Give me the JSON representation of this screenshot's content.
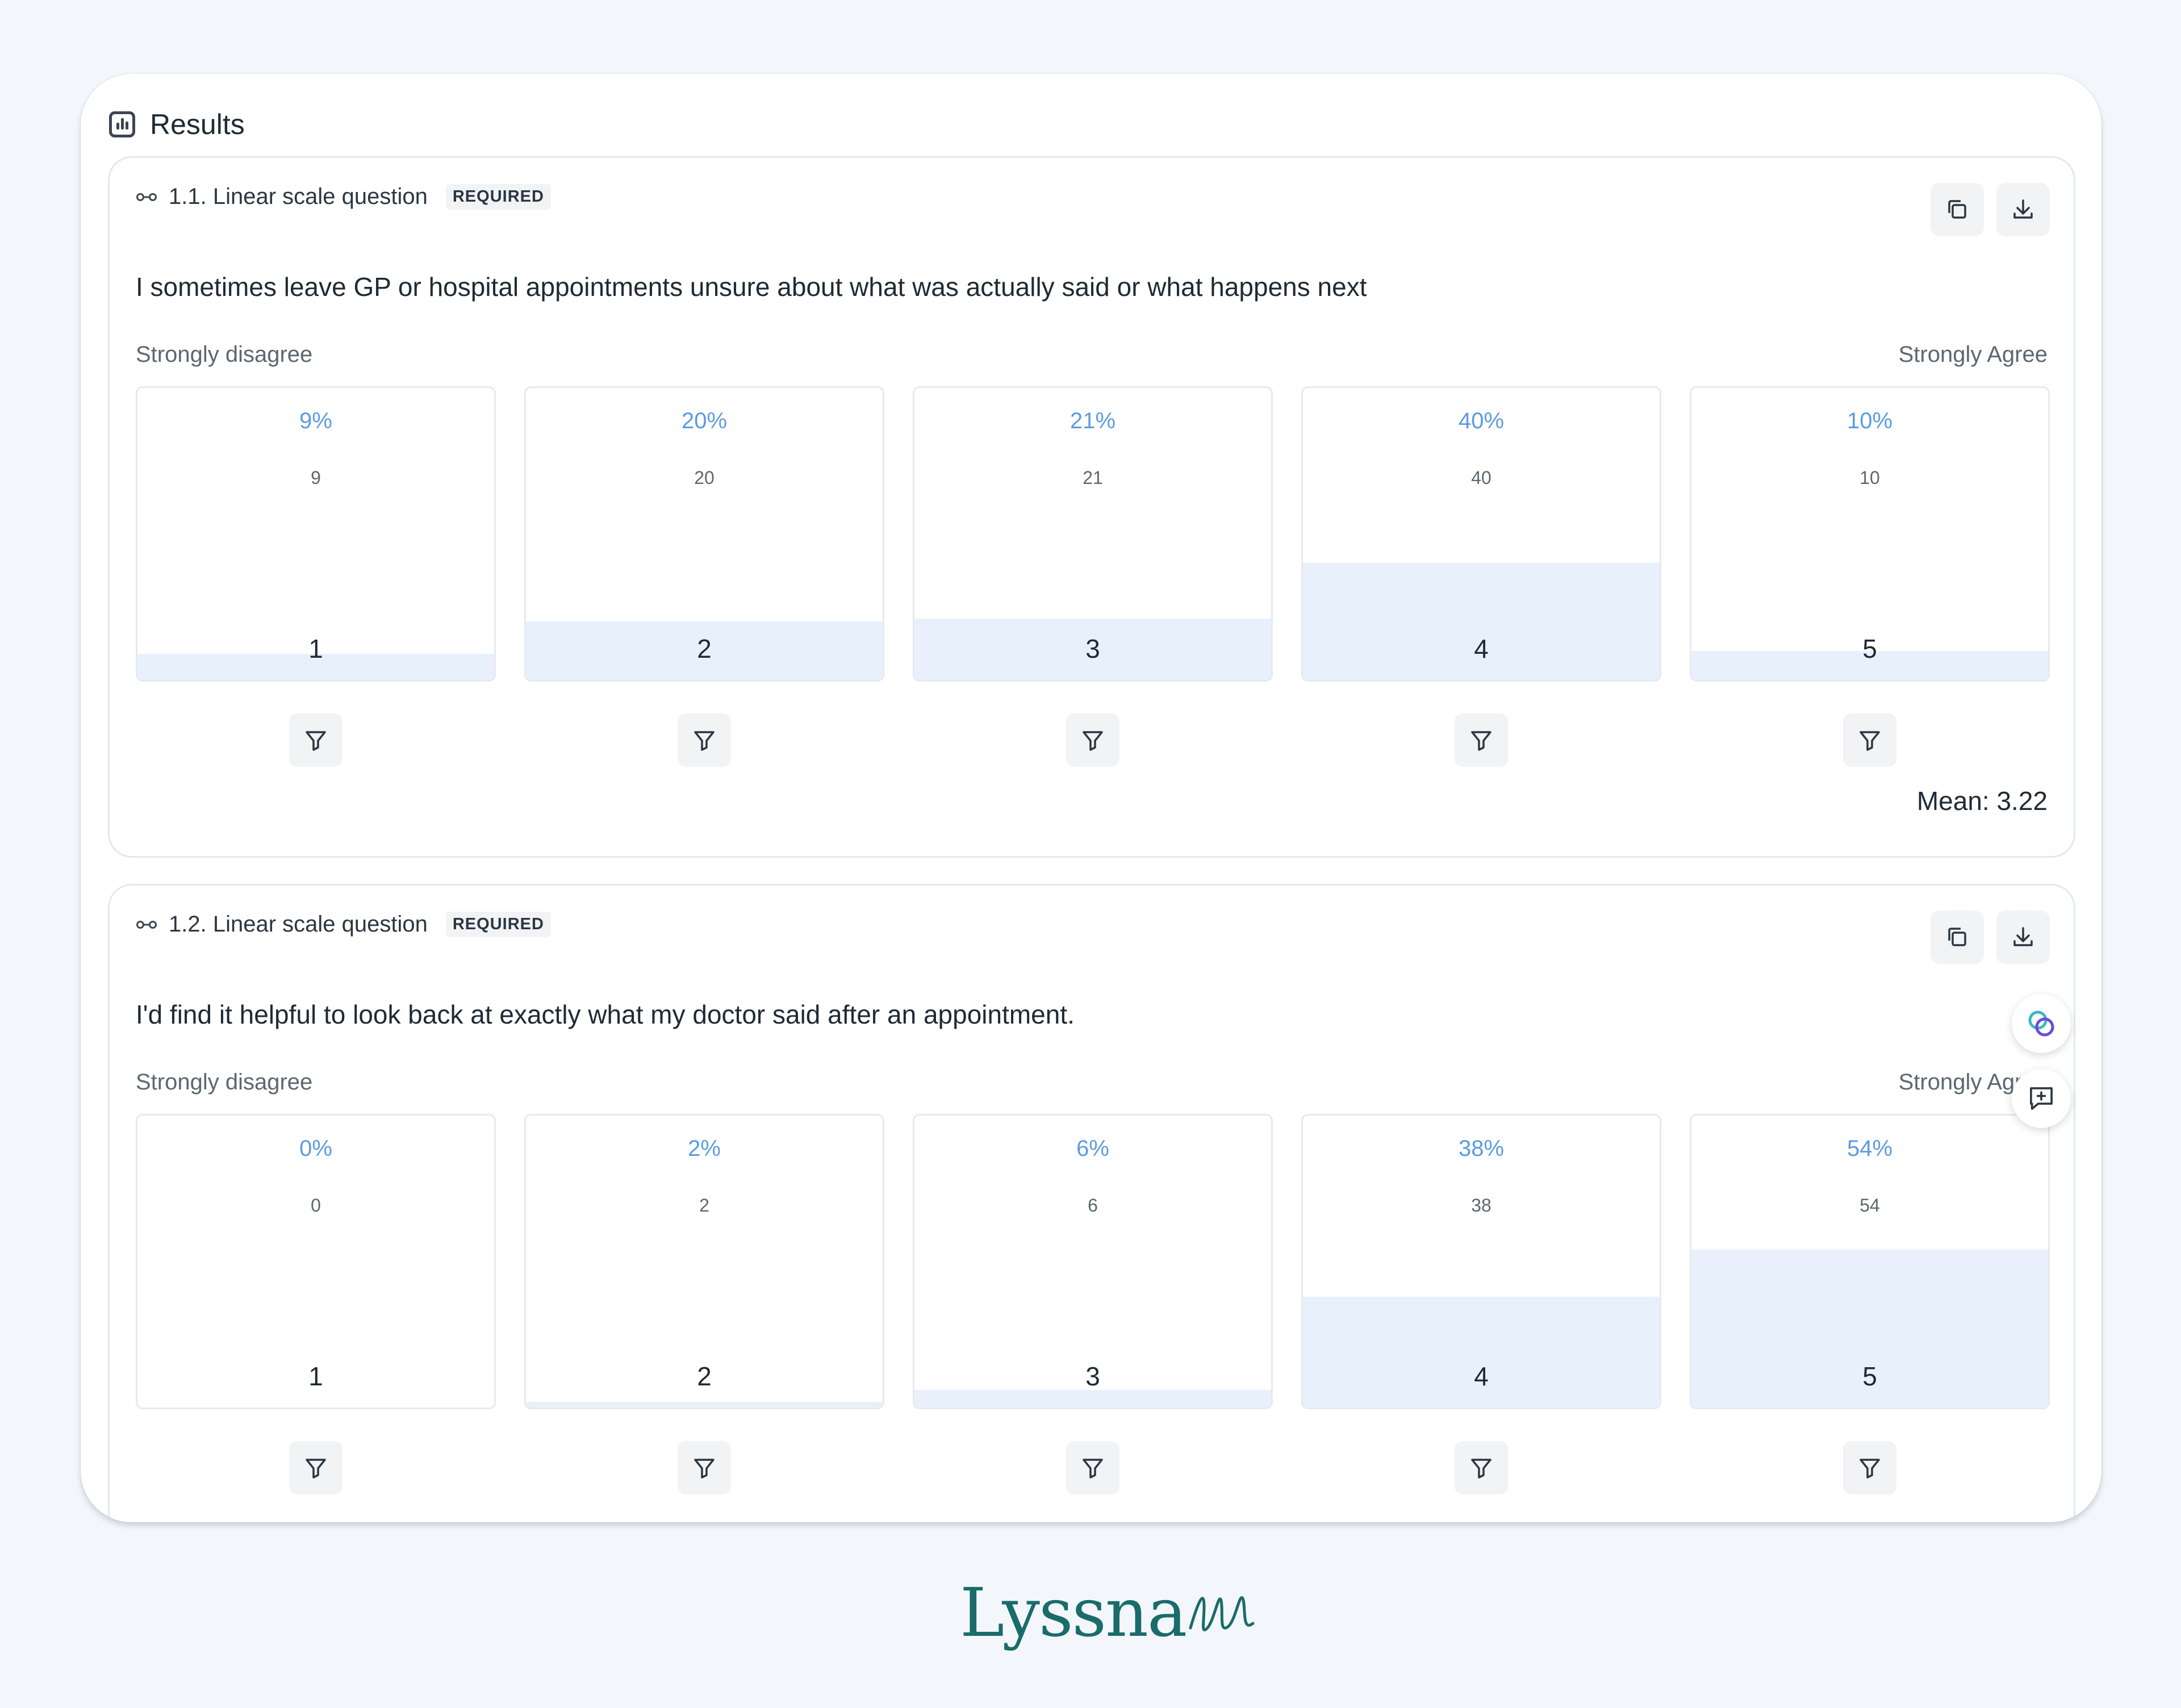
{
  "results": {
    "title": "Results"
  },
  "questions": [
    {
      "label": "1.1. Linear scale question",
      "badge": "REQUIRED",
      "text": "I sometimes leave GP or hospital appointments unsure about what was actually said or what happens next",
      "scale_left": "Strongly disagree",
      "scale_right": "Strongly Agree",
      "options": [
        {
          "pct": "9%",
          "count": "9",
          "scale": "1",
          "fraction": 0.09
        },
        {
          "pct": "20%",
          "count": "20",
          "scale": "2",
          "fraction": 0.2
        },
        {
          "pct": "21%",
          "count": "21",
          "scale": "3",
          "fraction": 0.21
        },
        {
          "pct": "40%",
          "count": "40",
          "scale": "4",
          "fraction": 0.4
        },
        {
          "pct": "10%",
          "count": "10",
          "scale": "5",
          "fraction": 0.1
        }
      ],
      "mean": "Mean: 3.22"
    },
    {
      "label": "1.2. Linear scale question",
      "badge": "REQUIRED",
      "text": "I'd find it helpful to look back at exactly what my doctor said after an appointment.",
      "scale_left": "Strongly disagree",
      "scale_right": "Strongly Agree",
      "options": [
        {
          "pct": "0%",
          "count": "0",
          "scale": "1",
          "fraction": 0.0
        },
        {
          "pct": "2%",
          "count": "2",
          "scale": "2",
          "fraction": 0.02
        },
        {
          "pct": "6%",
          "count": "6",
          "scale": "3",
          "fraction": 0.06
        },
        {
          "pct": "38%",
          "count": "38",
          "scale": "4",
          "fraction": 0.38
        },
        {
          "pct": "54%",
          "count": "54",
          "scale": "5",
          "fraction": 0.54
        }
      ]
    }
  ],
  "icons": {
    "results": "bar-chart-icon",
    "question_type": "link-icon",
    "copy": "copy-icon",
    "download": "download-icon",
    "filter": "filter-icon",
    "ai": "ai-assistant-icon",
    "feedback": "feedback-icon"
  },
  "brand": {
    "logo_text": "Lyssna",
    "color": "#1a6c6a"
  },
  "colors": {
    "accent": "#5c9be0",
    "bar_fill": "#e8f1fb"
  }
}
